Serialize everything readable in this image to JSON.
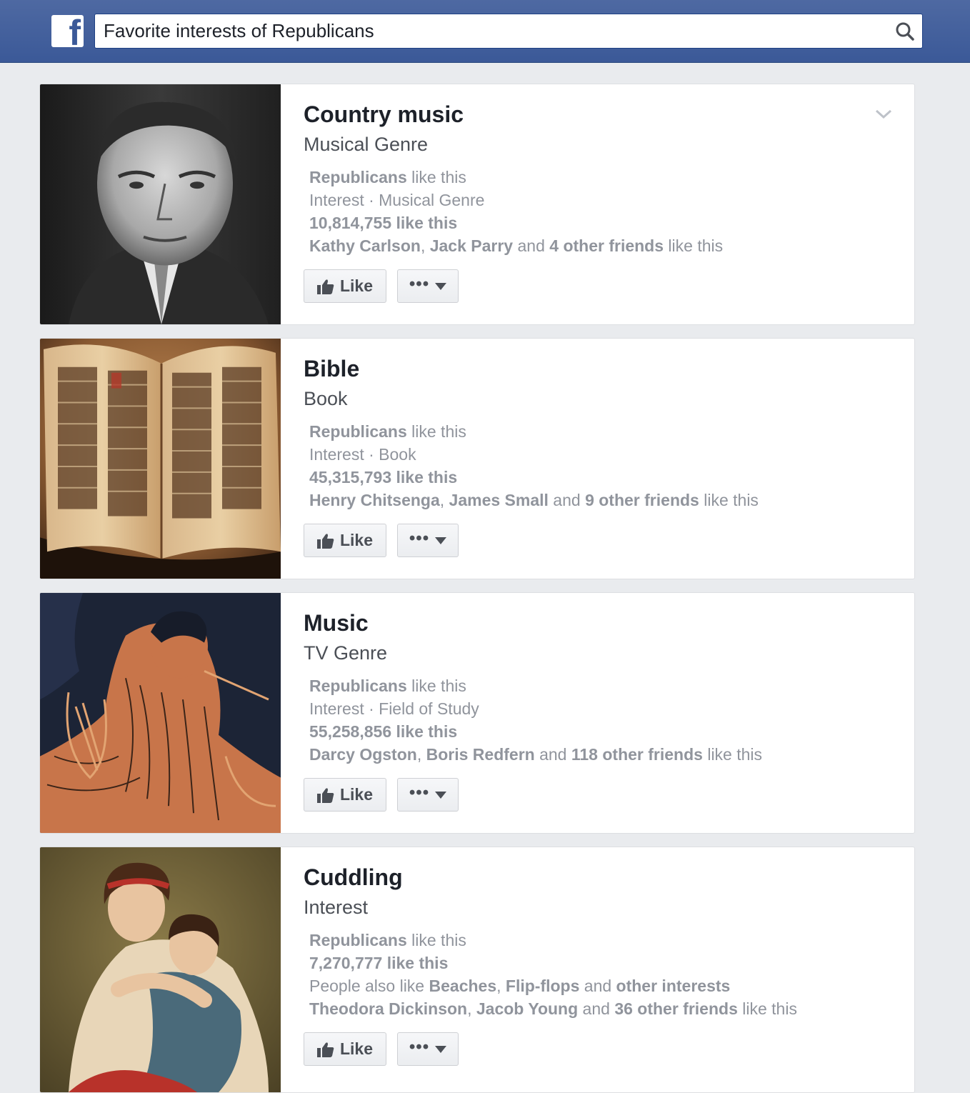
{
  "search": {
    "logo_glyph": "f",
    "query": "Favorite interests of Republicans"
  },
  "colors": {
    "brand_blue": "#3b5998",
    "background": "#e9ebee",
    "meta_text": "#90949c"
  },
  "results": [
    {
      "title": "Country music",
      "subtitle": "Musical Genre",
      "image": "portrait-photo",
      "line1": [
        "Republicans",
        " like this"
      ],
      "line2": "Interest · Musical Genre",
      "line3": "10,814,755 like this",
      "line4": [
        "Kathy Carlson",
        ", ",
        "Jack Parry",
        " and ",
        "4 other friends",
        " like this"
      ],
      "like_label": "Like",
      "more_label": "•••"
    },
    {
      "title": "Bible",
      "subtitle": "Book",
      "image": "open-book-photo",
      "line1": [
        "Republicans",
        " like this"
      ],
      "line2": "Interest · Book",
      "line3": "45,315,793 like this",
      "line4": [
        "Henry Chitsenga",
        ", ",
        "James Small",
        " and ",
        "9 other friends",
        " like this"
      ],
      "like_label": "Like",
      "more_label": "•••"
    },
    {
      "title": "Music",
      "subtitle": "TV Genre",
      "image": "greek-vase-painting",
      "line1": [
        "Republicans",
        " like this"
      ],
      "line2": "Interest · Field of Study",
      "line3": "55,258,856 like this",
      "line4": [
        "Darcy Ogston",
        ", ",
        "Boris Redfern",
        " and ",
        "118 other friends",
        " like this"
      ],
      "like_label": "Like",
      "more_label": "•••"
    },
    {
      "title": "Cuddling",
      "subtitle": "Interest",
      "image": "mother-child-painting",
      "line1": [
        "Republicans",
        " like this"
      ],
      "line2": "7,270,777 like this",
      "line3": [
        "People also like ",
        "Beaches",
        ", ",
        "Flip-flops",
        " and ",
        "other interests"
      ],
      "line4": [
        "Theodora Dickinson",
        ", ",
        "Jacob Young",
        " and ",
        "36 other friends",
        " like this"
      ],
      "like_label": "Like",
      "more_label": "•••"
    }
  ]
}
